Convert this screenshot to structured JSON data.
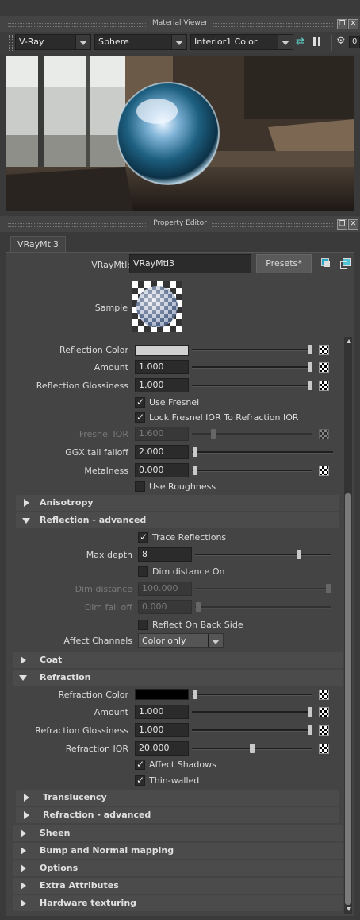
{
  "material_viewer": {
    "title": "Material Viewer",
    "renderer": "V-Ray",
    "shape": "Sphere",
    "environment": "Interior1 Color"
  },
  "property_editor": {
    "title": "Property Editor",
    "tab": "VRayMtl3",
    "node_type_label": "VRayMtl:",
    "node_name": "VRayMtl3",
    "presets_label": "Presets*",
    "sample_label": "Sample"
  },
  "reflection": {
    "color_label": "Reflection Color",
    "color_value": "#d0d0d0",
    "amount_label": "Amount",
    "amount": "1.000",
    "glossiness_label": "Reflection Glossiness",
    "glossiness": "1.000",
    "use_fresnel": "Use Fresnel",
    "lock_fresnel": "Lock Fresnel IOR To Refraction IOR",
    "fresnel_ior_label": "Fresnel IOR",
    "fresnel_ior": "1.600",
    "ggx_label": "GGX tail falloff",
    "ggx": "2.000",
    "metalness_label": "Metalness",
    "metalness": "0.000",
    "use_roughness": "Use Roughness"
  },
  "sections": {
    "anisotropy": "Anisotropy",
    "reflection_advanced": "Reflection - advanced",
    "coat": "Coat",
    "refraction": "Refraction",
    "translucency": "Translucency",
    "refraction_advanced": "Refraction - advanced",
    "sheen": "Sheen",
    "bump": "Bump and Normal mapping",
    "options": "Options",
    "extra": "Extra Attributes",
    "hardware": "Hardware texturing"
  },
  "reflection_advanced": {
    "trace_reflections": "Trace Reflections",
    "max_depth_label": "Max depth",
    "max_depth": "8",
    "dim_distance_on": "Dim distance On",
    "dim_distance_label": "Dim distance",
    "dim_distance": "100.000",
    "dim_falloff_label": "Dim fall off",
    "dim_falloff": "0.000",
    "reflect_back": "Reflect On Back Side",
    "affect_channels_label": "Affect Channels",
    "affect_channels": "Color only"
  },
  "refraction": {
    "color_label": "Refraction Color",
    "color_value": "#000000",
    "amount_label": "Amount",
    "amount": "1.000",
    "glossiness_label": "Refraction Glossiness",
    "glossiness": "1.000",
    "ior_label": "Refraction IOR",
    "ior": "20.000",
    "affect_shadows": "Affect Shadows",
    "thin_walled": "Thin-walled"
  }
}
